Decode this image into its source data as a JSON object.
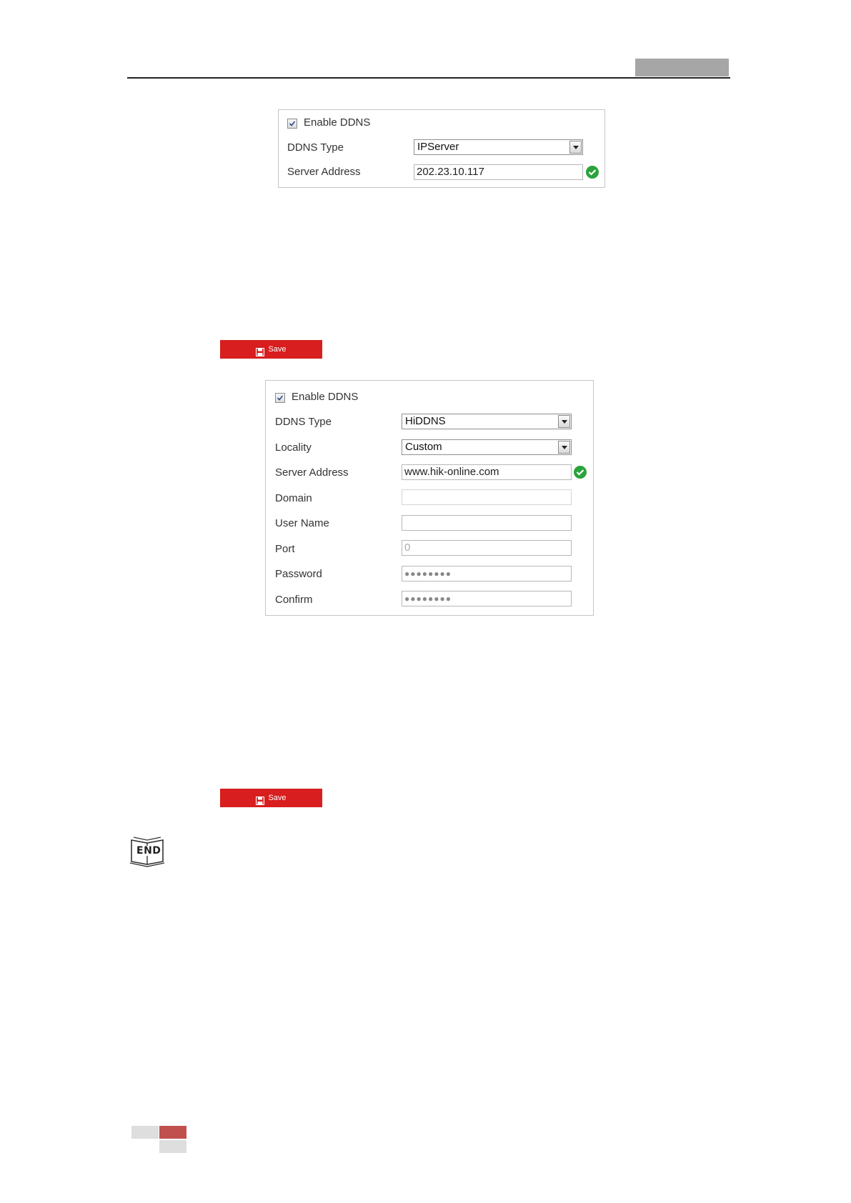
{
  "panel1": {
    "enable_label": "Enable DDNS",
    "enable_checked": true,
    "ddns_type_label": "DDNS Type",
    "ddns_type_value": "IPServer",
    "server_address_label": "Server Address",
    "server_address_value": "202.23.10.117"
  },
  "save_button_1": {
    "label": "Save"
  },
  "panel2": {
    "enable_label": "Enable DDNS",
    "enable_checked": true,
    "ddns_type_label": "DDNS Type",
    "ddns_type_value": "HiDDNS",
    "locality_label": "Locality",
    "locality_value": "Custom",
    "server_address_label": "Server Address",
    "server_address_value": "www.hik-online.com",
    "domain_label": "Domain",
    "domain_value": "",
    "user_name_label": "User Name",
    "user_name_value": "",
    "port_label": "Port",
    "port_value": "0",
    "password_label": "Password",
    "password_value": "●●●●●●●●",
    "confirm_label": "Confirm",
    "confirm_value": "●●●●●●●●"
  },
  "save_button_2": {
    "label": "Save"
  },
  "end_icon": {
    "text": "END",
    "icon": "book-end-icon"
  },
  "colors": {
    "save_red": "#d81e1e",
    "check_green": "#2aa33c",
    "header_tab_gray": "#a6a6a6",
    "footer_red": "#c0504d"
  }
}
